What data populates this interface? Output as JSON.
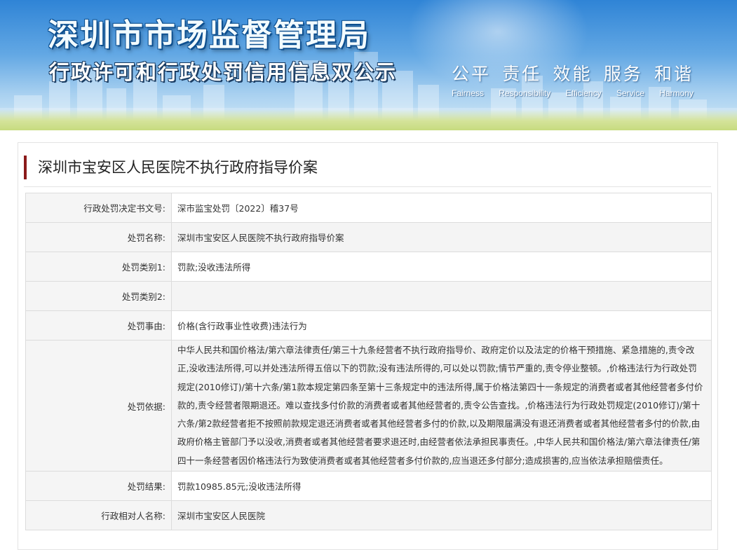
{
  "header": {
    "title": "深圳市市场监督管理局",
    "subtitle": "行政许可和行政处罚信用信息双公示",
    "slogans": [
      {
        "cn": "公平",
        "en": "Fairness"
      },
      {
        "cn": "责任",
        "en": "Responsibility"
      },
      {
        "cn": "效能",
        "en": "Efficiency"
      },
      {
        "cn": "服务",
        "en": "Service"
      },
      {
        "cn": "和谐",
        "en": "Harmony"
      }
    ]
  },
  "record": {
    "title": "深圳市宝安区人民医院不执行政府指导价案",
    "rows": [
      {
        "label": "行政处罚决定书文号:",
        "value": "深市监宝处罚〔2022〕稽37号"
      },
      {
        "label": "处罚名称:",
        "value": "深圳市宝安区人民医院不执行政府指导价案"
      },
      {
        "label": "处罚类别1:",
        "value": "罚款;没收违法所得"
      },
      {
        "label": "处罚类别2:",
        "value": ""
      },
      {
        "label": "处罚事由:",
        "value": "价格(含行政事业性收费)违法行为"
      },
      {
        "label": "处罚依据:",
        "value": "中华人民共和国价格法/第六章法律责任/第三十九条经营者不执行政府指导价、政府定价以及法定的价格干预措施、紧急措施的,责令改正,没收违法所得,可以并处违法所得五倍以下的罚款;没有违法所得的,可以处以罚款;情节严重的,责令停业整顿。,价格违法行为行政处罚规定(2010修订)/第十六条/第1款本规定第四条至第十三条规定中的违法所得,属于价格法第四十一条规定的消费者或者其他经营者多付价款的,责令经营者限期退还。难以查找多付价款的消费者或者其他经营者的,责令公告查找。,价格违法行为行政处罚规定(2010修订)/第十六条/第2款经营者拒不按照前款规定退还消费者或者其他经营者多付的价款,以及期限届满没有退还消费者或者其他经营者多付的价款,由政府价格主管部门予以没收,消费者或者其他经营者要求退还时,由经营者依法承担民事责任。,中华人民共和国价格法/第六章法律责任/第四十一条经营者因价格违法行为致使消费者或者其他经营者多付价款的,应当退还多付部分;造成损害的,应当依法承担赔偿责任。"
      },
      {
        "label": "处罚结果:",
        "value": "罚款10985.85元;没收违法所得"
      },
      {
        "label": "行政相对人名称:",
        "value": "深圳市宝安区人民医院"
      }
    ]
  }
}
